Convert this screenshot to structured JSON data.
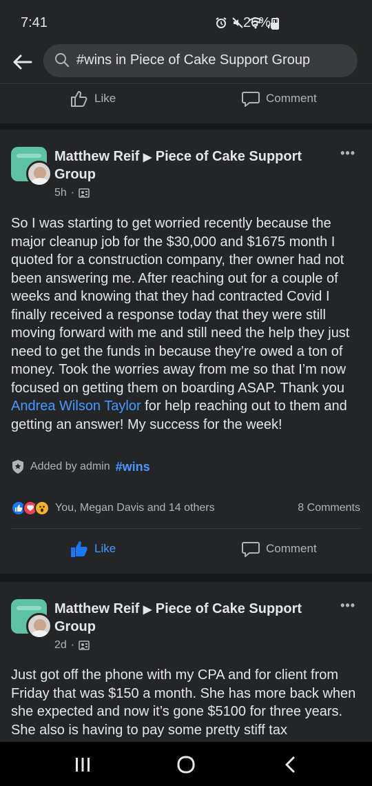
{
  "status": {
    "time": "7:41",
    "battery": "26%"
  },
  "search": {
    "query": "#wins in Piece of Cake Support Group"
  },
  "top_actions": {
    "like": "Like",
    "comment": "Comment"
  },
  "posts": [
    {
      "author": "Matthew Reif",
      "group_line1": "Piece of Cake Support",
      "group_line2": "Group",
      "time": "5h",
      "separator": "·",
      "more": "•••",
      "body_before_mention": "So I was starting to get worried recently because the major cleanup job for the $30,000 and $1675 month I quoted for a construction company, ther owner had not been answering me. After reaching out for a couple of weeks and knowing that they had contracted Covid I finally received a response today that they were still moving forward with me and still need the help they just need to get the funds in because they’re owed a ton of money. Took the worries away from me so that I’m now focused on getting them on boarding ASAP. Thank you ",
      "mention": "Andrea Wilson Taylor",
      "body_after_mention": " for help reaching out to them and getting an answer! My success for the week!",
      "added_by": "Added by admin",
      "tag": "#wins",
      "reactions_text": "You, Megan Davis and 14 others",
      "comments_count": "8 Comments",
      "like": "Like",
      "comment": "Comment"
    },
    {
      "author": "Matthew Reif",
      "group_line1": "Piece of Cake Support",
      "group_line2": "Group",
      "time": "2d",
      "separator": "·",
      "more": "•••",
      "body": "Just got off the phone with my CPA and for client from Friday that was $150 a month. She has more back when she expected and now it’s gone $5100 for three years. She also is having to pay some pretty stiff tax"
    }
  ],
  "colors": {
    "accent": "#4599ff",
    "background": "#18191a",
    "card": "#242526"
  }
}
